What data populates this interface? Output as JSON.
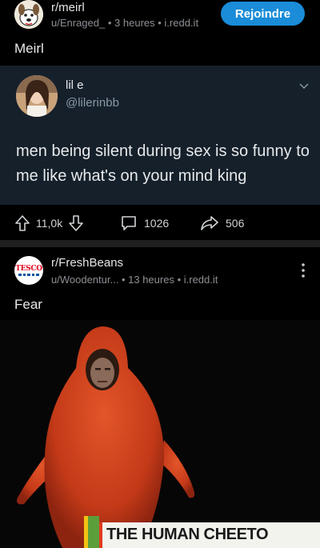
{
  "post1": {
    "subreddit": "r/meirl",
    "author": "u/Enraged_",
    "time": "3 heures",
    "domain": "i.redd.it",
    "join_label": "Rejoindre",
    "title": "Meirl",
    "tweet": {
      "name": "lil e",
      "handle": "@lilerinbb",
      "text": "men being silent during sex is so funny to me like what's on your mind king"
    },
    "actions": {
      "score": "11,0k",
      "comments": "1026",
      "shares": "506"
    }
  },
  "post2": {
    "subreddit": "r/FreshBeans",
    "author": "u/Woodentur...",
    "time": "13 heures",
    "domain": "i.redd.it",
    "title": "Fear",
    "avatar_text": "TESCO",
    "image_caption": "THE HUMAN CHEETO"
  },
  "colors": {
    "background": "#000000",
    "tweet_background": "#15202b",
    "join_button": "#1a8cd8",
    "meta_text": "#8b8f94",
    "cheeto_orange": "#d2431c"
  },
  "icons": {
    "upvote": "arrow-up-outline-icon",
    "downvote": "arrow-down-outline-icon",
    "comment": "speech-bubble-icon",
    "share": "share-arrow-icon",
    "more": "vertical-ellipsis-icon",
    "chevron": "chevron-down-icon"
  }
}
